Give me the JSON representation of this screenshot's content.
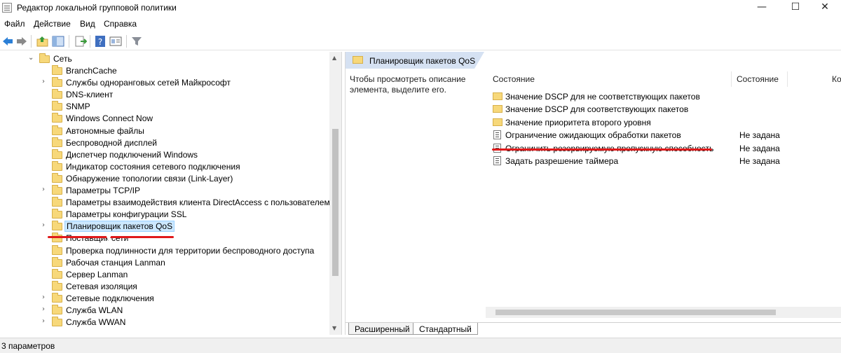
{
  "window": {
    "title": "Редактор локальной групповой политики",
    "minimize": "—",
    "maximize": "☐",
    "close": "✕"
  },
  "menu": [
    "Файл",
    "Действие",
    "Вид",
    "Справка"
  ],
  "toolbar": [
    "back-icon",
    "forward-icon",
    "up-folder-icon",
    "show-hide-tree-icon",
    "export-list-icon",
    "help-icon",
    "properties-icon",
    "filter-icon"
  ],
  "tree": {
    "root": "Сеть",
    "items": [
      {
        "label": "BranchCache",
        "expandable": false
      },
      {
        "label": "Службы одноранговых сетей Майкрософт",
        "expandable": true
      },
      {
        "label": "DNS-клиент",
        "expandable": false
      },
      {
        "label": "SNMP",
        "expandable": false
      },
      {
        "label": "Windows Connect Now",
        "expandable": false
      },
      {
        "label": "Автономные файлы",
        "expandable": false
      },
      {
        "label": "Беспроводной дисплей",
        "expandable": false
      },
      {
        "label": "Диспетчер подключений Windows",
        "expandable": false
      },
      {
        "label": "Индикатор состояния сетевого подключения",
        "expandable": false
      },
      {
        "label": "Обнаружение топологии связи (Link-Layer)",
        "expandable": false
      },
      {
        "label": "Параметры TCP/IP",
        "expandable": true
      },
      {
        "label": "Параметры взаимодействия клиента DirectAccess с пользователем",
        "expandable": false
      },
      {
        "label": "Параметры конфигурации SSL",
        "expandable": false
      },
      {
        "label": "Планировщик пакетов QoS",
        "expandable": true,
        "selected": true
      },
      {
        "label": "Поставщик сети",
        "expandable": false
      },
      {
        "label": "Проверка подлинности для территории беспроводного доступа",
        "expandable": false
      },
      {
        "label": "Рабочая станция Lanman",
        "expandable": false
      },
      {
        "label": "Сервер Lanman",
        "expandable": false
      },
      {
        "label": "Сетевая изоляция",
        "expandable": false
      },
      {
        "label": "Сетевые подключения",
        "expandable": true
      },
      {
        "label": "Служба WLAN",
        "expandable": true
      },
      {
        "label": "Служба WWAN",
        "expandable": true
      }
    ]
  },
  "right": {
    "header": "Планировщик пакетов QoS",
    "description": "Чтобы просмотреть описание элемента, выделите его.",
    "columns": [
      "Состояние",
      "Состояние",
      "Ко"
    ],
    "rows": [
      {
        "name": "Значение DSCP для не соответствующих пакетов",
        "state": "",
        "kind": "folder"
      },
      {
        "name": "Значение DSCP для соответствующих пакетов",
        "state": "",
        "kind": "folder"
      },
      {
        "name": "Значение приоритета второго уровня",
        "state": "",
        "kind": "folder"
      },
      {
        "name": "Ограничение ожидающих обработки пакетов",
        "state": "Не задана",
        "kind": "setting"
      },
      {
        "name": "Ограничить резервируемую пропускную способность",
        "state": "Не задана",
        "kind": "setting"
      },
      {
        "name": "Задать разрешение таймера",
        "state": "Не задана",
        "kind": "setting"
      }
    ],
    "tabs": [
      "Расширенный",
      "Стандартный"
    ]
  },
  "status": "3 параметров",
  "colors": {
    "selection": "#cce8ff",
    "annotation": "#e0191a",
    "header_band": "#d5e1f2"
  }
}
